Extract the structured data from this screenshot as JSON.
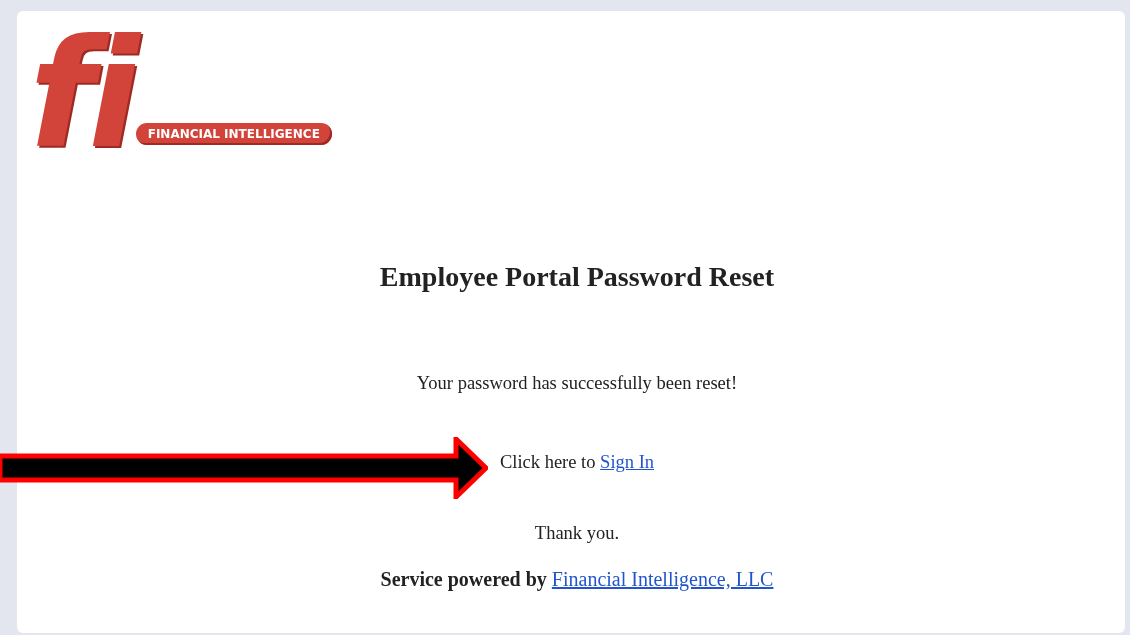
{
  "logo": {
    "mark": "fi",
    "tagline": "FINANCIAL INTELLIGENCE"
  },
  "heading": "Employee Portal Password Reset",
  "message": "Your password has successfully been reset!",
  "sign_in": {
    "prefix": "Click here to",
    "link": "Sign In"
  },
  "thanks": "Thank you.",
  "footer": {
    "prefix": "Service powered by",
    "link": "Financial Intelligence, LLC"
  }
}
